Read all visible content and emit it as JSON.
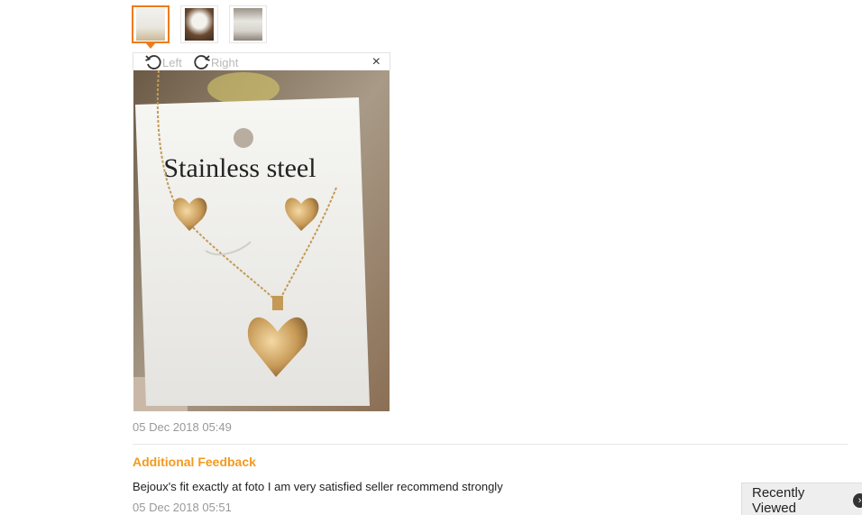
{
  "thumbnails": [
    {
      "label": "",
      "active": true
    },
    {
      "label": "",
      "active": false
    },
    {
      "label": "",
      "active": false
    }
  ],
  "viewer": {
    "rotate_left_label": "Left",
    "rotate_right_label": "Right",
    "close_symbol": "×",
    "photo_caption": "Stainless steel"
  },
  "review": {
    "date": "05 Dec 2018 05:49",
    "additional_title": "Additional Feedback",
    "additional_text": "Bejoux's fit exactly at foto I am very satisfied seller recommend strongly",
    "additional_date": "05 Dec 2018 05:51"
  },
  "recently_viewed": {
    "label": "Recently Viewed"
  },
  "colors": {
    "accent": "#f07a1a",
    "feedback_title": "#f39a1e",
    "muted_text": "#999999"
  }
}
